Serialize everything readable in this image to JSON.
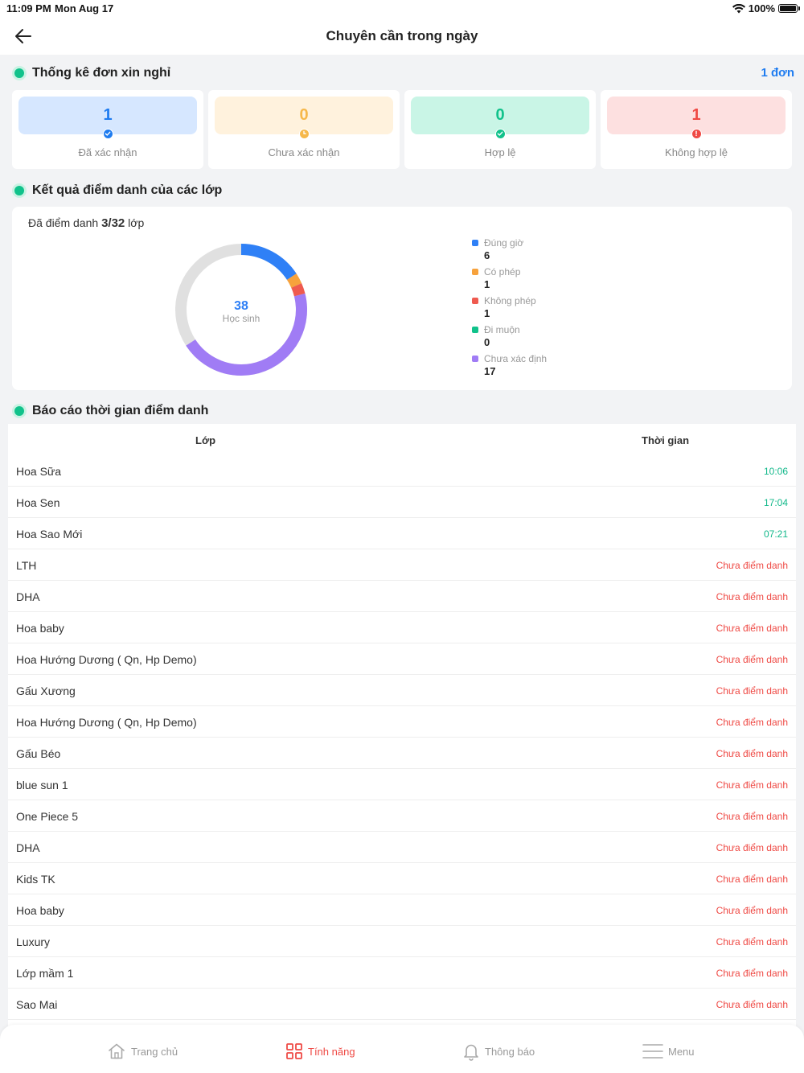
{
  "status": {
    "time": "11:09 PM",
    "date": "Mon Aug 17",
    "battery": "100%"
  },
  "header": {
    "title": "Chuyên cần trong ngày"
  },
  "leave_stats": {
    "title": "Thống kê đơn xin nghỉ",
    "count_link": "1 đơn",
    "cards": [
      {
        "value": "1",
        "label": "Đã xác nhận",
        "color": "#1f7cf0",
        "bg": "#d6e7ff"
      },
      {
        "value": "0",
        "label": "Chưa xác nhận",
        "color": "#f6b84b",
        "bg": "#fff2dd"
      },
      {
        "value": "0",
        "label": "Hợp lệ",
        "color": "#11c28b",
        "bg": "#c9f5e6"
      },
      {
        "value": "1",
        "label": "Không hợp lệ",
        "color": "#ef4a45",
        "bg": "#fde0e0"
      }
    ]
  },
  "attendance_result": {
    "title": "Kết quả điểm danh của các lớp",
    "summary_prefix": "Đã điểm danh",
    "summary_count": "3/32",
    "summary_suffix": "lớp",
    "center_value": "38",
    "center_label": "Học sinh",
    "legend": [
      {
        "label": "Đúng giờ",
        "value": 6,
        "color": "#2f80f6"
      },
      {
        "label": "Có phép",
        "value": 1,
        "color": "#f7a23c"
      },
      {
        "label": "Không phép",
        "value": 1,
        "color": "#ef5a4f"
      },
      {
        "label": "Đi muộn",
        "value": 0,
        "color": "#11c28b"
      },
      {
        "label": "Chưa xác định",
        "value": 17,
        "color": "#a07cf5"
      }
    ],
    "remainder_color": "#e0e0e0"
  },
  "report": {
    "title": "Báo cáo thời gian điểm danh",
    "col_class": "Lớp",
    "col_time": "Thời gian",
    "rows": [
      {
        "name": "Hoa Sữa",
        "time": "10:06",
        "status": "done"
      },
      {
        "name": "Hoa Sen",
        "time": "17:04",
        "status": "done"
      },
      {
        "name": "Hoa Sao Mới",
        "time": "07:21",
        "status": "done"
      },
      {
        "name": "LTH",
        "time": "Chưa điểm danh",
        "status": "pending"
      },
      {
        "name": "DHA",
        "time": "Chưa điểm danh",
        "status": "pending"
      },
      {
        "name": "Hoa baby",
        "time": "Chưa điểm danh",
        "status": "pending"
      },
      {
        "name": "Hoa Hướng Dương ( Qn, Hp Demo)",
        "time": "Chưa điểm danh",
        "status": "pending"
      },
      {
        "name": "Gấu Xương",
        "time": "Chưa điểm danh",
        "status": "pending"
      },
      {
        "name": "Hoa Hướng Dương ( Qn, Hp Demo)",
        "time": "Chưa điểm danh",
        "status": "pending"
      },
      {
        "name": "Gấu Béo",
        "time": "Chưa điểm danh",
        "status": "pending"
      },
      {
        "name": "blue sun 1",
        "time": "Chưa điểm danh",
        "status": "pending"
      },
      {
        "name": "One Piece 5",
        "time": "Chưa điểm danh",
        "status": "pending"
      },
      {
        "name": "DHA",
        "time": "Chưa điểm danh",
        "status": "pending"
      },
      {
        "name": "Kids TK",
        "time": "Chưa điểm danh",
        "status": "pending"
      },
      {
        "name": "Hoa baby",
        "time": "Chưa điểm danh",
        "status": "pending"
      },
      {
        "name": "Luxury",
        "time": "Chưa điểm danh",
        "status": "pending"
      },
      {
        "name": "Lớp mầm 1",
        "time": "Chưa điểm danh",
        "status": "pending"
      },
      {
        "name": "Sao Mai",
        "time": "Chưa điểm danh",
        "status": "pending"
      }
    ]
  },
  "tabbar": {
    "home": "Trang chủ",
    "features": "Tính năng",
    "notifications": "Thông báo",
    "menu": "Menu",
    "active_color": "#ef4a45"
  }
}
